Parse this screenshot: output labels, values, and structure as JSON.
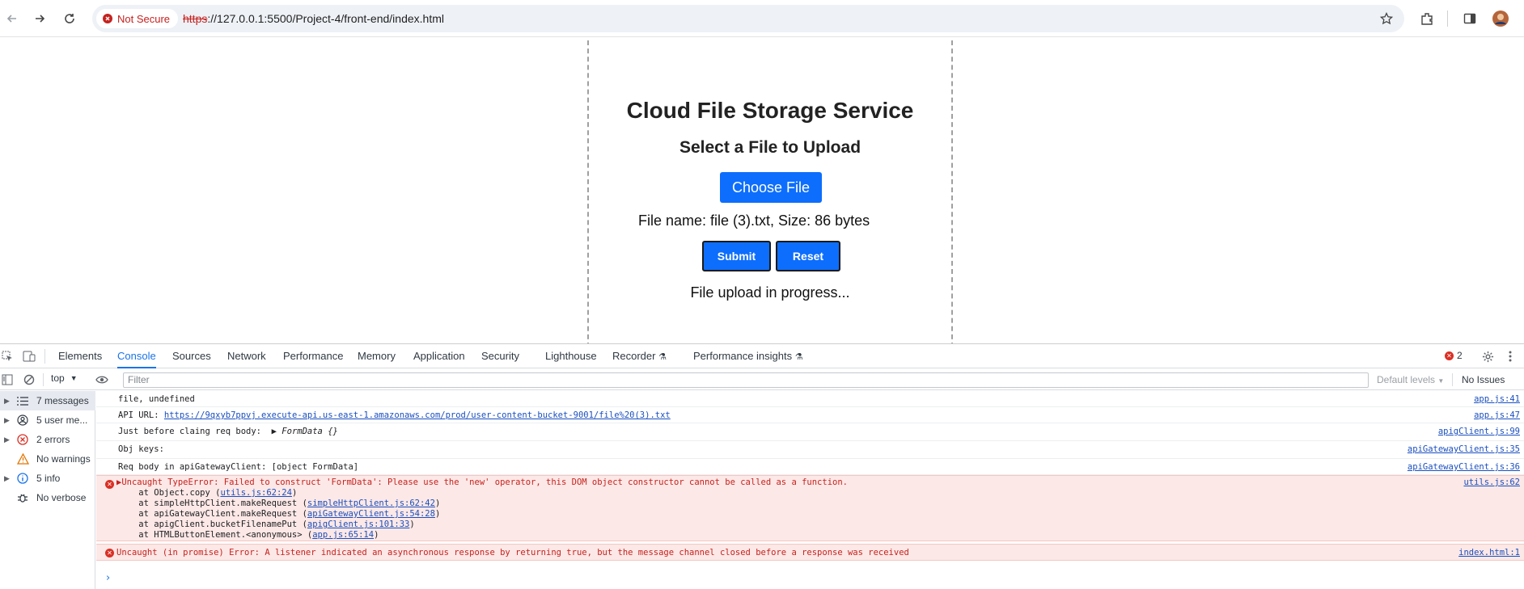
{
  "browser": {
    "security_label": "Not Secure",
    "url_scheme": "https",
    "url_rest": "://127.0.0.1:5500/Project-4/front-end/index.html",
    "icons": [
      "back-icon",
      "forward-icon",
      "reload-icon",
      "star-icon",
      "extensions-icon",
      "side-panel-icon",
      "profile-avatar"
    ]
  },
  "page": {
    "title": "Cloud File Storage Service",
    "subtitle": "Select a File to Upload",
    "choose_label": "Choose File",
    "file_info": "File name: file (3).txt, Size: 86 bytes",
    "submit_label": "Submit",
    "reset_label": "Reset",
    "status": "File upload in progress..."
  },
  "devtools": {
    "tabs": [
      "Elements",
      "Console",
      "Sources",
      "Network",
      "Performance",
      "Memory",
      "Application",
      "Security",
      "Lighthouse",
      "Recorder",
      "Performance insights"
    ],
    "active_tab": "Console",
    "error_count": "2",
    "context": "top",
    "filter_placeholder": "Filter",
    "levels": "Default levels",
    "issues": "No Issues",
    "sidebar": [
      {
        "label": "7 messages"
      },
      {
        "label": "5 user me..."
      },
      {
        "label": "2 errors"
      },
      {
        "label": "No warnings"
      },
      {
        "label": "5 info"
      },
      {
        "label": "No verbose"
      }
    ],
    "messages": [
      {
        "text": "file, undefined",
        "source": "app.js:41"
      },
      {
        "text": "API URL: ",
        "link": "https://9qxyb7ppvj.execute-api.us-east-1.amazonaws.com/prod/user-content-bucket-9001/file%20(3).txt",
        "source": "app.js:47"
      },
      {
        "text": "Just before claing req body:  ▶ ",
        "italic": "FormData {}",
        "source": "apigClient.js:99"
      },
      {
        "text": "Obj keys:",
        "source": "apiGatewayClient.js:35"
      },
      {
        "text": "Req body in apiGatewayClient: [object FormData]",
        "source": "apiGatewayClient.js:36"
      }
    ],
    "error1": {
      "text": "▶Uncaught TypeError: Failed to construct 'FormData': Please use the 'new' operator, this DOM object constructor cannot be called as a function.",
      "source": "utils.js:62",
      "stack": [
        {
          "prefix": "    at Object.copy (",
          "link": "utils.js:62:24",
          "suffix": ")"
        },
        {
          "prefix": "    at simpleHttpClient.makeRequest (",
          "link": "simpleHttpClient.js:62:42",
          "suffix": ")"
        },
        {
          "prefix": "    at apiGatewayClient.makeRequest (",
          "link": "apiGatewayClient.js:54:28",
          "suffix": ")"
        },
        {
          "prefix": "    at apigClient.bucketFilenamePut (",
          "link": "apigClient.js:101:33",
          "suffix": ")"
        },
        {
          "prefix": "    at HTMLButtonElement.<anonymous> (",
          "link": "app.js:65:14",
          "suffix": ")"
        }
      ]
    },
    "error2": {
      "text": "Uncaught (in promise) Error: A listener indicated an asynchronous response by returning true, but the message channel closed before a response was received",
      "source": "index.html:1"
    },
    "prompt": "›"
  }
}
